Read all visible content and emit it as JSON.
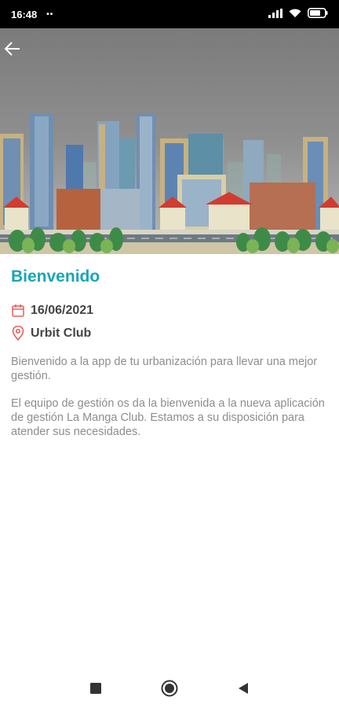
{
  "status_bar": {
    "time": "16:48",
    "indicators": "••",
    "icons": [
      "signal-icon",
      "wifi-icon",
      "battery-icon"
    ]
  },
  "hero": {
    "image": "city-skyline-illustration",
    "back_icon": "arrow-left-icon"
  },
  "post": {
    "title": "Bienvenido",
    "date": "16/06/2021",
    "location": "Urbit Club",
    "paragraphs": [
      "Bienvenido a la app de tu urbanización para llevar una mejor gestión.",
      "El equipo de gestión os da la bienvenida a la nueva aplicación de gestión La Manga Club. Estamos a su disposición para atender sus necesidades."
    ]
  },
  "nav_bar": {
    "buttons": [
      "recents-square-icon",
      "home-circle-icon",
      "back-triangle-icon"
    ]
  },
  "colors": {
    "accent": "#1aa6b4",
    "icon_red": "#e5605a",
    "body_text": "#8d8d8d"
  }
}
